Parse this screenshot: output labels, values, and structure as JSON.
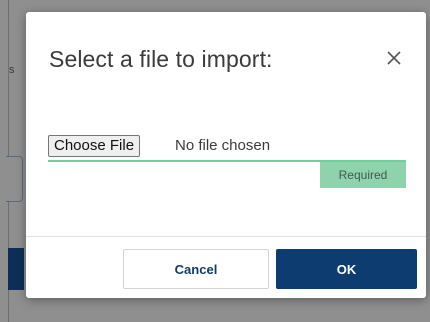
{
  "background": {
    "partial_text": "s"
  },
  "dialog": {
    "title": "Select a file to import:",
    "close_icon": "close-icon",
    "file_input": {
      "button_label": "Choose File",
      "status_text": "No file chosen"
    },
    "required_label": "Required",
    "buttons": {
      "cancel_label": "Cancel",
      "ok_label": "OK"
    }
  },
  "colors": {
    "primary": "#0d3d70",
    "valid_underline": "#6fcf9e",
    "required_badge": "#8fd3ad"
  }
}
